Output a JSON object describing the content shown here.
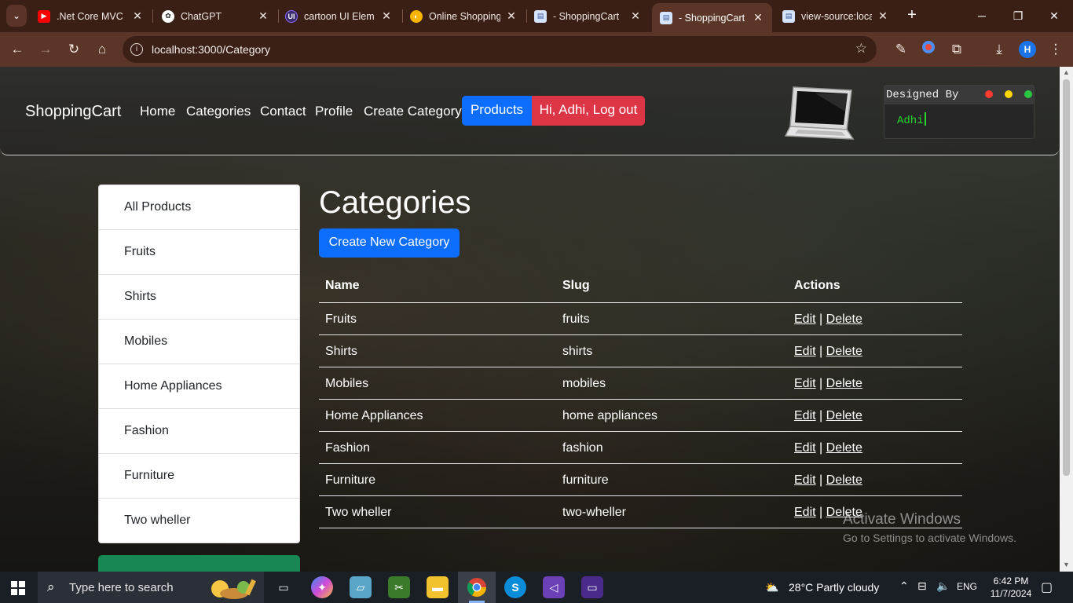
{
  "browser": {
    "tabs": [
      {
        "title": ".Net Core MVC (",
        "favicon": "youtube-icon",
        "color": "#ff0000"
      },
      {
        "title": "ChatGPT",
        "favicon": "chatgpt-icon",
        "color": "#ffffff"
      },
      {
        "title": "cartoon UI Elem",
        "favicon": "uiverse-icon",
        "color": "#6c3bd4"
      },
      {
        "title": "Online Shopping",
        "favicon": "shopping-icon",
        "color": "#f7b500"
      },
      {
        "title": "- ShoppingCart",
        "favicon": "page-icon",
        "color": "#d6e4ff"
      },
      {
        "title": "- ShoppingCart",
        "favicon": "page-icon",
        "color": "#d6e4ff",
        "active": true
      },
      {
        "title": "view-source:loca",
        "favicon": "page-icon",
        "color": "#d6e4ff"
      }
    ],
    "url": "localhost:3000/Category",
    "profile_initial": "H"
  },
  "navbar": {
    "brand": "ShoppingCart",
    "links": [
      "Home",
      "Categories",
      "Contact",
      "Profile",
      "Create Category"
    ],
    "products_label": "Products",
    "logout_label": "Hi, Adhi, Log out",
    "terminal_title": "Designed By",
    "terminal_text": "Adhi"
  },
  "sidebar": {
    "items": [
      "All Products",
      "Fruits",
      "Shirts",
      "Mobiles",
      "Home Appliances",
      "Fashion",
      "Furniture",
      "Two wheller"
    ]
  },
  "main": {
    "title": "Categories",
    "create_label": "Create New Category",
    "columns": [
      "Name",
      "Slug",
      "Actions"
    ],
    "rows": [
      {
        "name": "Fruits",
        "slug": "fruits"
      },
      {
        "name": "Shirts",
        "slug": "shirts"
      },
      {
        "name": "Mobiles",
        "slug": "mobiles"
      },
      {
        "name": "Home Appliances",
        "slug": "home appliances"
      },
      {
        "name": "Fashion",
        "slug": "fashion"
      },
      {
        "name": "Furniture",
        "slug": "furniture"
      },
      {
        "name": "Two wheller",
        "slug": "two-wheller"
      }
    ],
    "edit_label": "Edit",
    "separator": "|",
    "delete_label": "Delete"
  },
  "watermark": {
    "line1": "Activate Windows",
    "line2": "Go to Settings to activate Windows."
  },
  "taskbar": {
    "search_placeholder": "Type here to search",
    "weather": "28°C  Partly cloudy",
    "language": "ENG",
    "time": "6:42 PM",
    "date": "11/7/2024"
  },
  "colors": {
    "primary": "#0d6efd",
    "danger": "#dc3545",
    "success": "#198754",
    "chrome_frame": "#3a1f16",
    "chrome_toolbar": "#5b3528"
  }
}
